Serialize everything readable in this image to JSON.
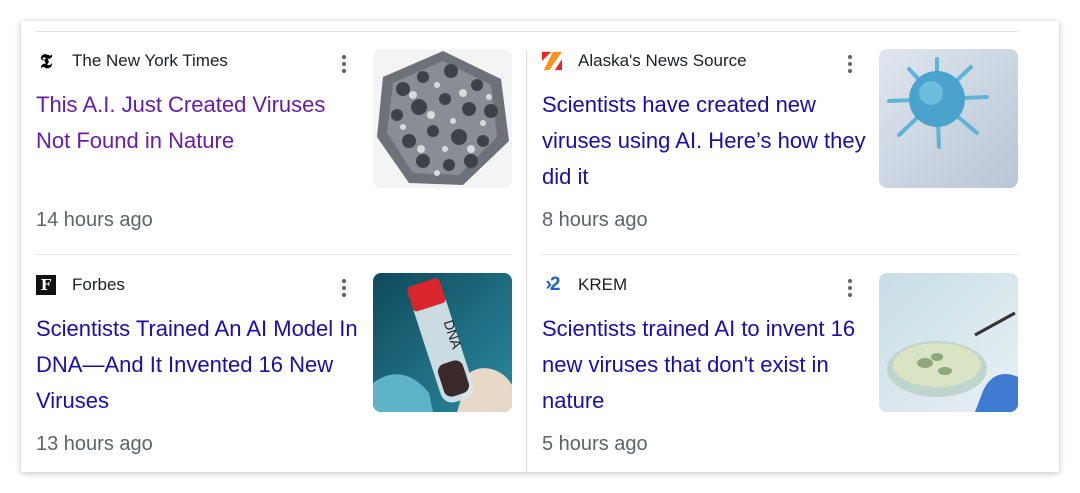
{
  "articles": [
    {
      "source": "The New York Times",
      "favicon": "nyt-logo-icon",
      "title": "This A.I. Just Created Viruses Not Found in Nature",
      "time": "14 hours ago",
      "visited": true,
      "thumbnail": "virus-capsid-image"
    },
    {
      "source": "Alaska's News Source",
      "favicon": "alaska-news-source-logo-icon",
      "title": "Scientists have created new viruses using AI. Here’s how they did it",
      "time": "8 hours ago",
      "visited": false,
      "thumbnail": "blue-virus-image"
    },
    {
      "source": "Forbes",
      "favicon": "forbes-logo-icon",
      "title": "Scientists Trained An AI Model In DNA—And It Invented 16 New Viruses",
      "time": "13 hours ago",
      "visited": false,
      "thumbnail": "dna-test-tube-image"
    },
    {
      "source": "KREM",
      "favicon": "krem-logo-icon",
      "title": "Scientists trained AI to invent 16 new viruses that don't exist in nature",
      "time": "5 hours ago",
      "visited": false,
      "thumbnail": "petri-dish-image"
    }
  ],
  "icons": {
    "more": "more-vert-icon",
    "nyt_glyph": "𝕿",
    "forbes_glyph": "F",
    "krem_glyph": "›2"
  },
  "colors": {
    "link": "#1a0dab",
    "visited": "#681da8",
    "time": "#5f6368",
    "source": "#202124"
  }
}
